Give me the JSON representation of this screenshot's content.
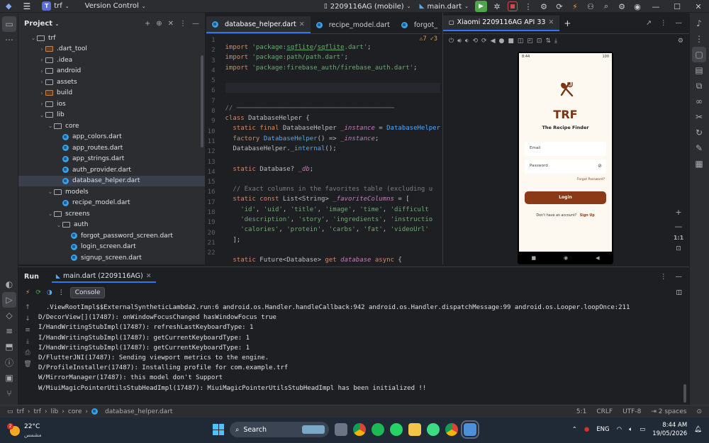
{
  "titlebar": {
    "project_badge": "T",
    "project_name": "trf",
    "vcs_label": "Version Control",
    "device": "2209116AG (mobile)",
    "run_config": "main.dart"
  },
  "project_panel": {
    "title": "Project",
    "tree": [
      {
        "label": "trf",
        "type": "folder",
        "depth": 0,
        "open": true
      },
      {
        "label": ".dart_tool",
        "type": "folder-orange",
        "depth": 1,
        "open": false
      },
      {
        "label": ".idea",
        "type": "folder",
        "depth": 1,
        "open": false
      },
      {
        "label": "android",
        "type": "folder",
        "depth": 1,
        "open": false
      },
      {
        "label": "assets",
        "type": "folder",
        "depth": 1,
        "open": false
      },
      {
        "label": "build",
        "type": "folder-orange",
        "depth": 1,
        "open": false
      },
      {
        "label": "ios",
        "type": "folder",
        "depth": 1,
        "open": false
      },
      {
        "label": "lib",
        "type": "folder",
        "depth": 1,
        "open": true
      },
      {
        "label": "core",
        "type": "folder",
        "depth": 2,
        "open": true
      },
      {
        "label": "app_colors.dart",
        "type": "dart",
        "depth": 3
      },
      {
        "label": "app_routes.dart",
        "type": "dart",
        "depth": 3
      },
      {
        "label": "app_strings.dart",
        "type": "dart",
        "depth": 3
      },
      {
        "label": "auth_provider.dart",
        "type": "dart",
        "depth": 3
      },
      {
        "label": "database_helper.dart",
        "type": "dart",
        "depth": 3,
        "selected": true
      },
      {
        "label": "models",
        "type": "folder",
        "depth": 2,
        "open": true
      },
      {
        "label": "recipe_model.dart",
        "type": "dart",
        "depth": 3
      },
      {
        "label": "screens",
        "type": "folder",
        "depth": 2,
        "open": true
      },
      {
        "label": "auth",
        "type": "folder",
        "depth": 3,
        "open": true
      },
      {
        "label": "forgot_password_screen.dart",
        "type": "dart",
        "depth": 4
      },
      {
        "label": "login_screen.dart",
        "type": "dart",
        "depth": 4
      },
      {
        "label": "signup_screen.dart",
        "type": "dart",
        "depth": 4
      }
    ]
  },
  "editor": {
    "tabs": [
      {
        "label": "database_helper.dart",
        "active": true
      },
      {
        "label": "recipe_model.dart",
        "active": false
      },
      {
        "label": "forgot_",
        "active": false
      }
    ],
    "warnings": "⚠7 ✓3",
    "line_numbers": [
      "1",
      "2",
      "3",
      "4",
      "5",
      "6",
      "7",
      "8",
      "9",
      "10",
      "11",
      "12",
      "13",
      "14",
      "15",
      "16",
      "17",
      "18",
      "19",
      "20",
      "21",
      "22"
    ]
  },
  "emulator": {
    "tab_label": "Xiaomi 2209116AG API 33",
    "app": {
      "status_time": "8:44",
      "status_battery": "100",
      "brand": "TRF",
      "tagline": "The Recipe Finder",
      "email_label": "Email",
      "password_label": "Password",
      "forgot_link": "Forgot Password?",
      "login_button": "Login",
      "signup_prompt": "Don't have an account?",
      "signup_link": "Sign Up"
    },
    "zoom_ratio": "1:1"
  },
  "run_panel": {
    "title": "Run",
    "tab": "main.dart (2209116AG)",
    "console_tab": "Console",
    "lines": [
      "  .ViewRootImpl$$ExternalSyntheticLambda2.run:6 android.os.Handler.handleCallback:942 android.os.Handler.dispatchMessage:99 android.os.Looper.loopOnce:211",
      "D/DecorView[](17487): onWindowFocusChanged hasWindowFocus true",
      "I/HandWritingStubImpl(17487): refreshLastKeyboardType: 1",
      "I/HandWritingStubImpl(17487): getCurrentKeyboardType: 1",
      "I/HandWritingStubImpl(17487): getCurrentKeyboardType: 1",
      "D/FlutterJNI(17487): Sending viewport metrics to the engine.",
      "D/ProfileInstaller(17487): Installing profile for com.example.trf",
      "W/MirrorManager(17487): this model don't Support",
      "W/MiuiMagicPointerUtilsStubHeadImpl(17487): MiuiMagicPointerUtilsStubHeadImpl has been initialized !!"
    ]
  },
  "statusbar": {
    "crumbs": [
      "trf",
      "trf",
      "lib",
      "core",
      "database_helper.dart"
    ],
    "position": "5:1",
    "line_ending": "CRLF",
    "encoding": "UTF-8",
    "indent": "2 spaces"
  },
  "taskbar": {
    "temp": "22°C",
    "weather_text": "مشمس",
    "weather_badge": "2",
    "search_label": "Search",
    "lang": "ENG",
    "time": "8:44 AM",
    "date": "19/05/2026"
  }
}
